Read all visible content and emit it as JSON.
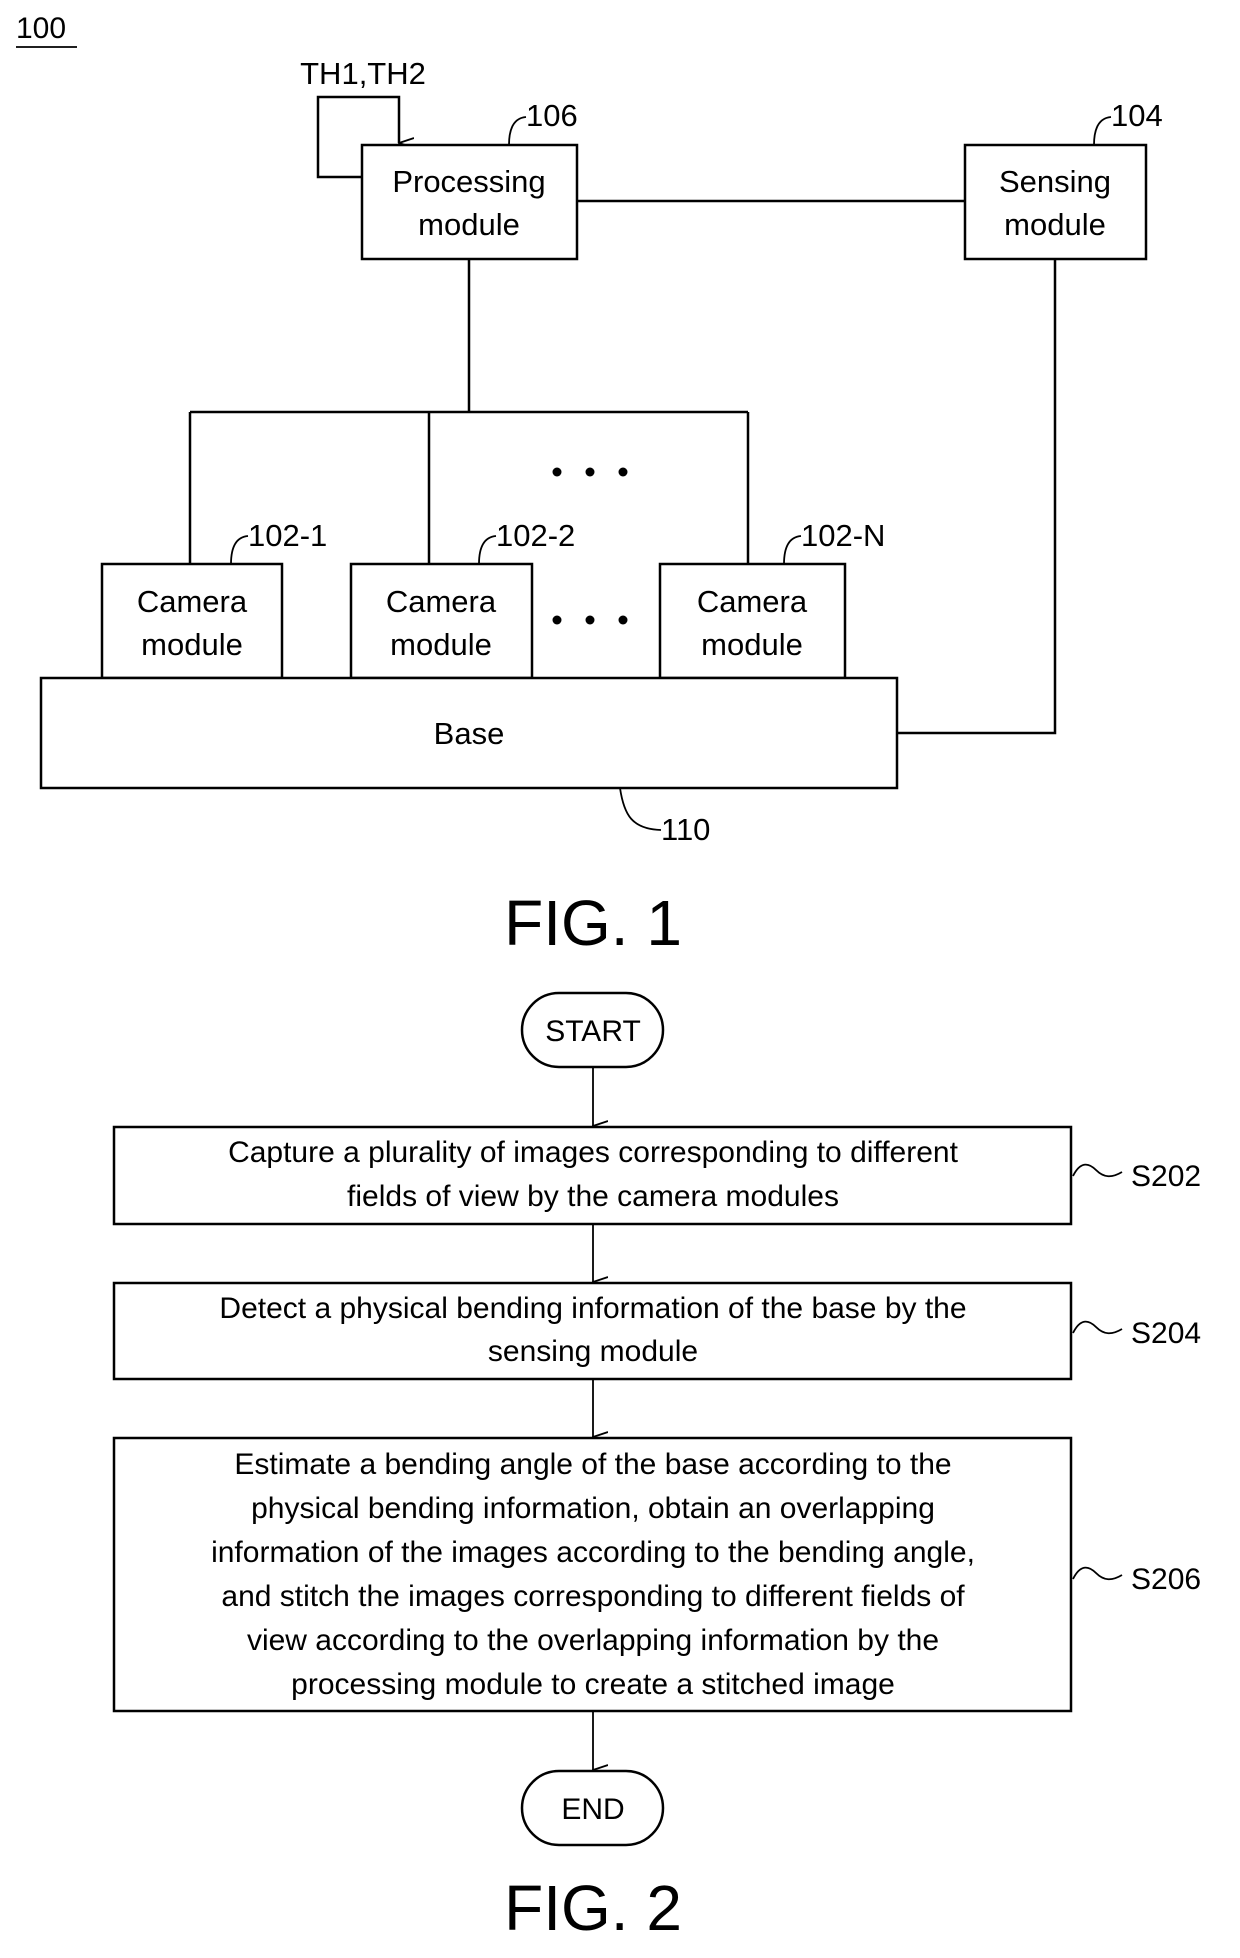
{
  "fig1": {
    "system_ref": "100",
    "threshold_input": "TH1,TH2",
    "processing_module": {
      "ref": "106",
      "lines": [
        "Processing",
        "module"
      ]
    },
    "sensing_module": {
      "ref": "104",
      "lines": [
        "Sensing",
        "module"
      ]
    },
    "camera_modules": [
      {
        "ref": "102-1",
        "lines": [
          "Camera",
          "module"
        ]
      },
      {
        "ref": "102-2",
        "lines": [
          "Camera",
          "module"
        ]
      },
      {
        "ref": "102-N",
        "lines": [
          "Camera",
          "module"
        ]
      }
    ],
    "ellipsis": "• • •",
    "base": {
      "ref": "110",
      "label": "Base"
    },
    "caption": "FIG. 1"
  },
  "fig2": {
    "start_label": "START",
    "end_label": "END",
    "steps": [
      {
        "id": "S202",
        "lines": [
          "Capture a plurality of images corresponding to different",
          "fields of view by the camera modules"
        ]
      },
      {
        "id": "S204",
        "lines": [
          "Detect a physical bending information of the base by the",
          "sensing module"
        ]
      },
      {
        "id": "S206",
        "lines": [
          "Estimate a bending angle of the base according to the",
          "physical bending information, obtain an overlapping",
          "information of the images according to the bending angle,",
          "and stitch the images corresponding to different fields of",
          "view according to the overlapping information by the",
          "processing module to create a stitched image"
        ]
      }
    ],
    "caption": "FIG. 2"
  }
}
